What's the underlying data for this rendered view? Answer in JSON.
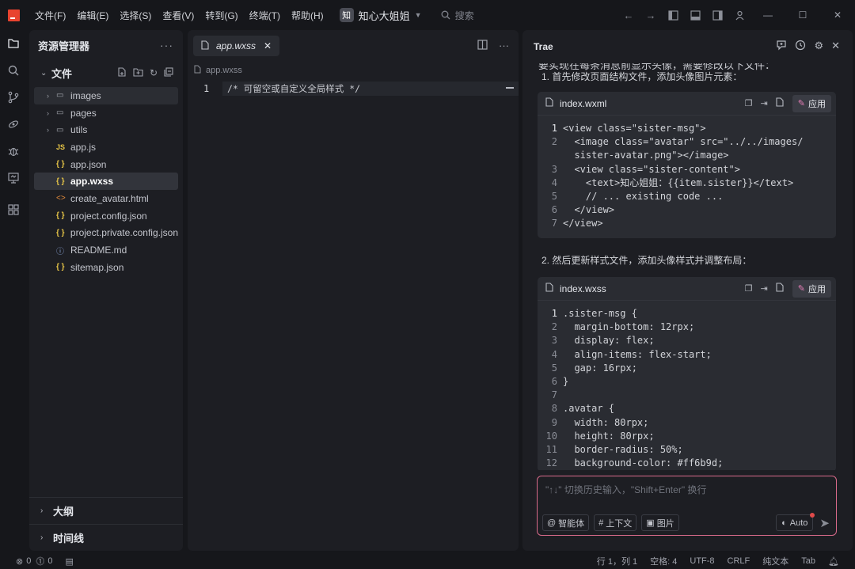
{
  "titlebar": {
    "menus": [
      "文件(F)",
      "编辑(E)",
      "选择(S)",
      "查看(V)",
      "转到(G)",
      "终端(T)",
      "帮助(H)"
    ],
    "workspace_badge": "知",
    "workspace_name": "知心大姐姐",
    "search_placeholder": "搜索"
  },
  "explorer": {
    "title": "资源管理器",
    "more": "···",
    "section_title": "文件",
    "tree": [
      {
        "type": "folder",
        "name": "images",
        "selected": true
      },
      {
        "type": "folder",
        "name": "pages"
      },
      {
        "type": "folder",
        "name": "utils"
      },
      {
        "type": "file",
        "icon": "JS",
        "name": "app.js"
      },
      {
        "type": "file",
        "icon": "{ }",
        "name": "app.json"
      },
      {
        "type": "file",
        "icon": "{ }",
        "name": "app.wxss",
        "active": true
      },
      {
        "type": "file",
        "icon": "<>",
        "name": "create_avatar.html"
      },
      {
        "type": "file",
        "icon": "{ }",
        "name": "project.config.json"
      },
      {
        "type": "file",
        "icon": "{ }",
        "name": "project.private.config.json"
      },
      {
        "type": "file",
        "icon": "ⓘ",
        "name": "README.md"
      },
      {
        "type": "file",
        "icon": "{ }",
        "name": "sitemap.json"
      }
    ],
    "outline": "大纲",
    "timeline": "时间线"
  },
  "editor": {
    "tab_label": "app.wxss",
    "tab_close": "✕",
    "breadcrumb": "app.wxss",
    "lines": [
      {
        "num": "1",
        "text": "/* 可留空或自定义全局样式 */"
      }
    ]
  },
  "ai": {
    "title": "Trae",
    "intro_cut": "要实现在每条消息前显示头像，需要修改以下文件：",
    "step1": "1. 首先修改页面结构文件，添加头像图片元素：",
    "step2": "2. 然后更新样式文件，添加头像样式并调整布局：",
    "card1": {
      "filename": "index.wxml",
      "apply": "应用",
      "lines": [
        {
          "n": "1",
          "t": "<view class=\"sister-msg\">"
        },
        {
          "n": "2",
          "t": "  <image class=\"avatar\" src=\"../../images/"
        },
        {
          "n": "",
          "t": "  sister-avatar.png\"></image>"
        },
        {
          "n": "3",
          "t": "  <view class=\"sister-content\">"
        },
        {
          "n": "4",
          "t": "    <text>知心姐姐：{{item.sister}}</text>"
        },
        {
          "n": "5",
          "t": "    // ... existing code ..."
        },
        {
          "n": "6",
          "t": "  </view>"
        },
        {
          "n": "7",
          "t": "</view>"
        }
      ]
    },
    "card2": {
      "filename": "index.wxss",
      "apply": "应用",
      "lines": [
        {
          "n": "1",
          "t": ".sister-msg {"
        },
        {
          "n": "2",
          "t": "  margin-bottom: 12rpx;"
        },
        {
          "n": "3",
          "t": "  display: flex;"
        },
        {
          "n": "4",
          "t": "  align-items: flex-start;"
        },
        {
          "n": "5",
          "t": "  gap: 16rpx;"
        },
        {
          "n": "6",
          "t": "}"
        },
        {
          "n": "7",
          "t": ""
        },
        {
          "n": "8",
          "t": ".avatar {"
        },
        {
          "n": "9",
          "t": "  width: 80rpx;"
        },
        {
          "n": "10",
          "t": "  height: 80rpx;"
        },
        {
          "n": "11",
          "t": "  border-radius: 50%;"
        },
        {
          "n": "12",
          "t": "  background-color: #ff6b9d;"
        }
      ]
    },
    "input": {
      "placeholder": "\"↑↓\" 切换历史输入，\"Shift+Enter\" 换行",
      "agent": "智能体",
      "context": "上下文",
      "image": "图片",
      "mode": "Auto"
    }
  },
  "statusbar": {
    "errors": "0",
    "warnings": "0",
    "position": "行 1，列 1",
    "spaces": "空格: 4",
    "encoding": "UTF-8",
    "eol": "CRLF",
    "language": "纯文本",
    "indent": "Tab"
  }
}
